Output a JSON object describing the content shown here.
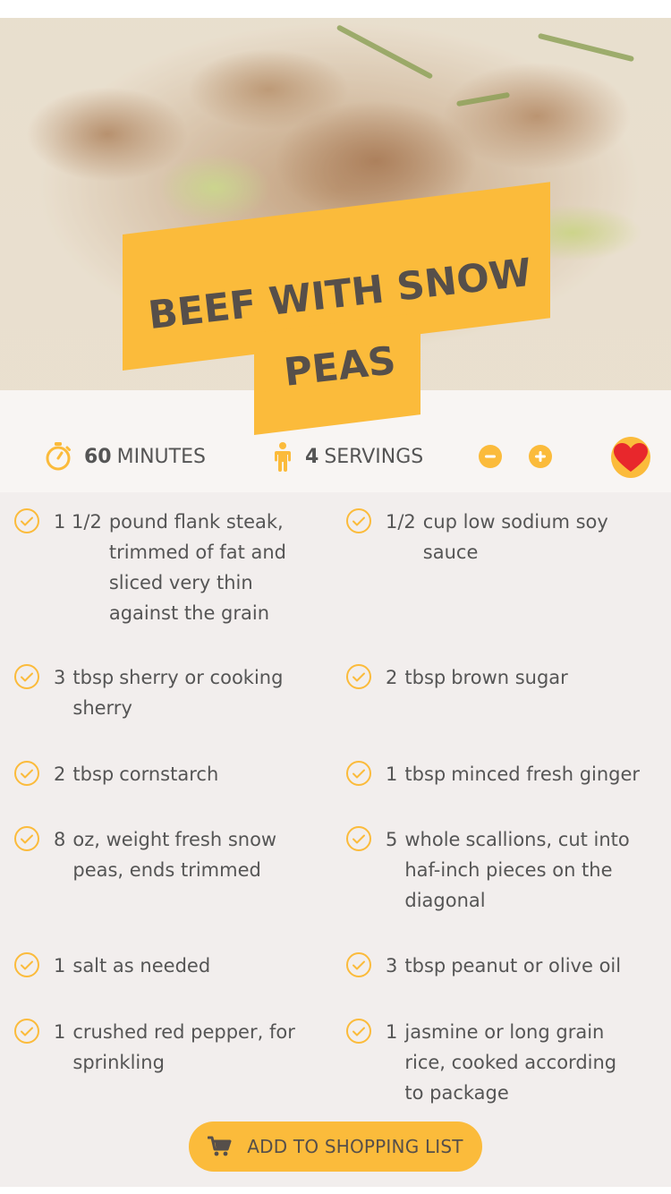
{
  "recipe": {
    "title_line1": "BEEF WITH SNOW",
    "title_line2": "PEAS",
    "time": {
      "value": "60",
      "label": "MINUTES",
      "icon": "stopwatch-icon"
    },
    "servings": {
      "value": "4",
      "label": "SERVINGS",
      "icon": "person-icon"
    },
    "favorite_icon": "heart-icon"
  },
  "colors": {
    "accent": "#fbbb3b",
    "text": "#555555",
    "heart": "#e8272c",
    "band": "#f8f5f3",
    "content_bg": "#f2eeed"
  },
  "ingredients": [
    {
      "qty": "1 1/2",
      "unit": "",
      "desc": "pound flank steak, trimmed of fat and sliced very thin against the grain"
    },
    {
      "qty": "1/2",
      "unit": "",
      "desc": "cup low sodium soy sauce"
    },
    {
      "qty": "3",
      "unit": "tbsp",
      "desc": "sherry or cooking sherry"
    },
    {
      "qty": "2",
      "unit": "tbsp",
      "desc": "brown sugar"
    },
    {
      "qty": "2",
      "unit": "tbsp",
      "desc": "cornstarch"
    },
    {
      "qty": "1",
      "unit": "tbsp",
      "desc": "minced fresh ginger"
    },
    {
      "qty": "8",
      "unit": "oz, weight",
      "desc": "fresh snow peas, ends trimmed"
    },
    {
      "qty": "5",
      "unit": "whole",
      "desc": "scallions, cut into haf-inch pieces on the diagonal"
    },
    {
      "qty": "1",
      "unit": "",
      "desc": "salt as needed"
    },
    {
      "qty": "3",
      "unit": "tbsp",
      "desc": "peanut or olive oil"
    },
    {
      "qty": "1",
      "unit": "",
      "desc": "crushed red pepper, for sprinkling"
    },
    {
      "qty": "1",
      "unit": "",
      "desc": "jasmine or long grain rice, cooked according to package"
    }
  ],
  "actions": {
    "add_to_list": "ADD TO SHOPPING LIST",
    "cart_icon": "cart-icon",
    "decrease_icon": "minus-icon",
    "increase_icon": "plus-icon"
  }
}
